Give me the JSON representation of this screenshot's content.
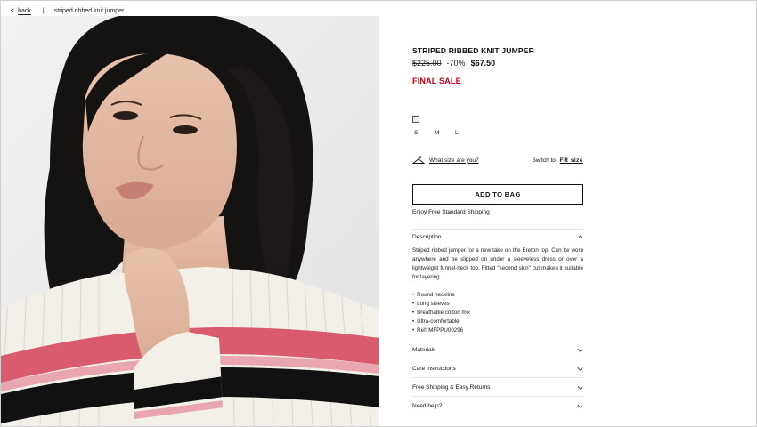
{
  "breadcrumb": {
    "back_label": "back",
    "separator": "|",
    "current": "striped ribbed knit jumper"
  },
  "product": {
    "title": "STRIPED RIBBED KNIT JUMPER",
    "price_original": "$225.00",
    "discount": "-70%",
    "price_sale": "$67.50",
    "sale_label": "FINAL SALE",
    "swatch_color": "#f4efdc",
    "sizes": [
      "S",
      "M",
      "L"
    ],
    "size_guide_label": "What size are you?",
    "switch_to_label": "Switch to",
    "switch_unit": "FR size",
    "add_to_bag": "ADD TO BAG",
    "shipping_note": "Enjoy Free Standard Shipping"
  },
  "description": {
    "heading": "Description",
    "body": "Striped ribbed jumper for a new take on the Breton top. Can be worn anywhere and be slipped on under a sleeveless dress or over a lightweight funnel-neck top. Fitted \"second skin\" cut makes it suitable for layering.",
    "bullets": [
      "Round neckline",
      "Long sleeves",
      "Breathable cotton mix",
      "Ultra-comfortable",
      "Ref: MFPPU00296"
    ]
  },
  "accordion": [
    {
      "label": "Materials"
    },
    {
      "label": "Care instructions"
    },
    {
      "label": "Free Shipping & Easy Returns"
    },
    {
      "label": "Need help?"
    }
  ],
  "colors": {
    "sale_red": "#c0061a",
    "stripe_pink": "#d85b6f",
    "stripe_black": "#111111",
    "knit_cream": "#f3f0ea"
  }
}
